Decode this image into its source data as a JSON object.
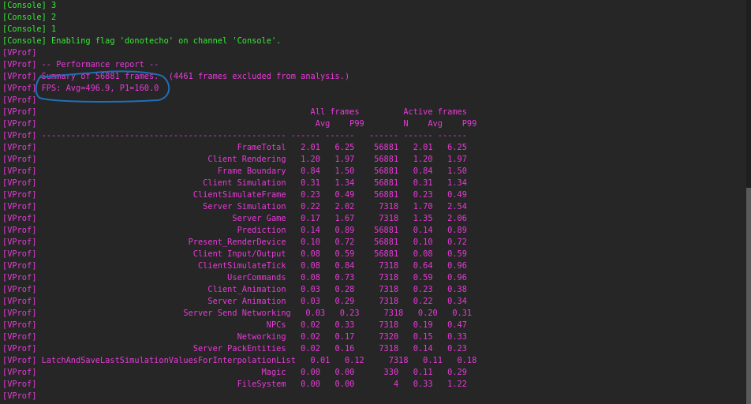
{
  "lines": [
    {
      "kind": "console",
      "text": "[Console] 3"
    },
    {
      "kind": "console",
      "text": "[Console] 2"
    },
    {
      "kind": "console",
      "text": "[Console] 1"
    },
    {
      "kind": "console",
      "text": "[Console] Enabling flag 'donotecho' on channel 'Console'."
    },
    {
      "kind": "vprof",
      "text": "[VProf]"
    },
    {
      "kind": "vprof",
      "text": "[VProf] -- Performance report --"
    },
    {
      "kind": "vprof",
      "text": "[VProf] Summary of 56881 frames.  (4461 frames excluded from analysis.)"
    },
    {
      "kind": "vprof",
      "text": "[VProf] FPS: Avg=496.9, P1=160.0"
    },
    {
      "kind": "vprof",
      "text": "[VProf]"
    },
    {
      "kind": "vprof",
      "text": "[VProf]                                                        All frames         Active frames"
    },
    {
      "kind": "vprof",
      "text": "[VProf]                                                         Avg    P99        N    Avg    P99"
    },
    {
      "kind": "vprof",
      "text": "[VProf] -------------------------------------------------- ------ ------   ------ ------ ------"
    },
    {
      "kind": "vprof",
      "text": "[VProf]                                         FrameTotal   2.01   6.25    56881   2.01   6.25"
    },
    {
      "kind": "vprof",
      "text": "[VProf]                                   Client Rendering   1.20   1.97    56881   1.20   1.97"
    },
    {
      "kind": "vprof",
      "text": "[VProf]                                     Frame Boundary   0.84   1.50    56881   0.84   1.50"
    },
    {
      "kind": "vprof",
      "text": "[VProf]                                  Client Simulation   0.31   1.34    56881   0.31   1.34"
    },
    {
      "kind": "vprof",
      "text": "[VProf]                                ClientSimulateFrame   0.23   0.49    56881   0.23   0.49"
    },
    {
      "kind": "vprof",
      "text": "[VProf]                                  Server Simulation   0.22   2.02     7318   1.70   2.54"
    },
    {
      "kind": "vprof",
      "text": "[VProf]                                        Server Game   0.17   1.67     7318   1.35   2.06"
    },
    {
      "kind": "vprof",
      "text": "[VProf]                                         Prediction   0.14   0.89    56881   0.14   0.89"
    },
    {
      "kind": "vprof",
      "text": "[VProf]                               Present_RenderDevice   0.10   0.72    56881   0.10   0.72"
    },
    {
      "kind": "vprof",
      "text": "[VProf]                                Client Input/Output   0.08   0.59    56881   0.08   0.59"
    },
    {
      "kind": "vprof",
      "text": "[VProf]                                 ClientSimulateTick   0.08   0.84     7318   0.64   0.96"
    },
    {
      "kind": "vprof",
      "text": "[VProf]                                       UserCommands   0.08   0.73     7318   0.59   0.96"
    },
    {
      "kind": "vprof",
      "text": "[VProf]                                   Client_Animation   0.03   0.28     7318   0.23   0.38"
    },
    {
      "kind": "vprof",
      "text": "[VProf]                                   Server Animation   0.03   0.29     7318   0.22   0.34"
    },
    {
      "kind": "vprof",
      "text": "[VProf]                              Server Send Networking   0.03   0.23     7318   0.20   0.31"
    },
    {
      "kind": "vprof",
      "text": "[VProf]                                               NPCs   0.02   0.33     7318   0.19   0.47"
    },
    {
      "kind": "vprof",
      "text": "[VProf]                                         Networking   0.02   0.17     7320   0.15   0.33"
    },
    {
      "kind": "vprof",
      "text": "[VProf]                                Server PackEntities   0.02   0.16     7318   0.14   0.23"
    },
    {
      "kind": "vprof",
      "text": "[VProf] LatchAndSaveLastSimulationValuesForInterpolationList   0.01   0.12     7318   0.11   0.18"
    },
    {
      "kind": "vprof",
      "text": "[VProf]                                              Magic   0.00   0.00      330   0.11   0.29"
    },
    {
      "kind": "vprof",
      "text": "[VProf]                                         FileSystem   0.00   0.00        4   0.33   1.22"
    },
    {
      "kind": "vprof",
      "text": "[VProf]"
    }
  ],
  "colors": {
    "background": "#262626",
    "console_text": "#39e639",
    "vprof_text": "#e83ad8",
    "annotation_stroke": "#1f6fb8"
  }
}
